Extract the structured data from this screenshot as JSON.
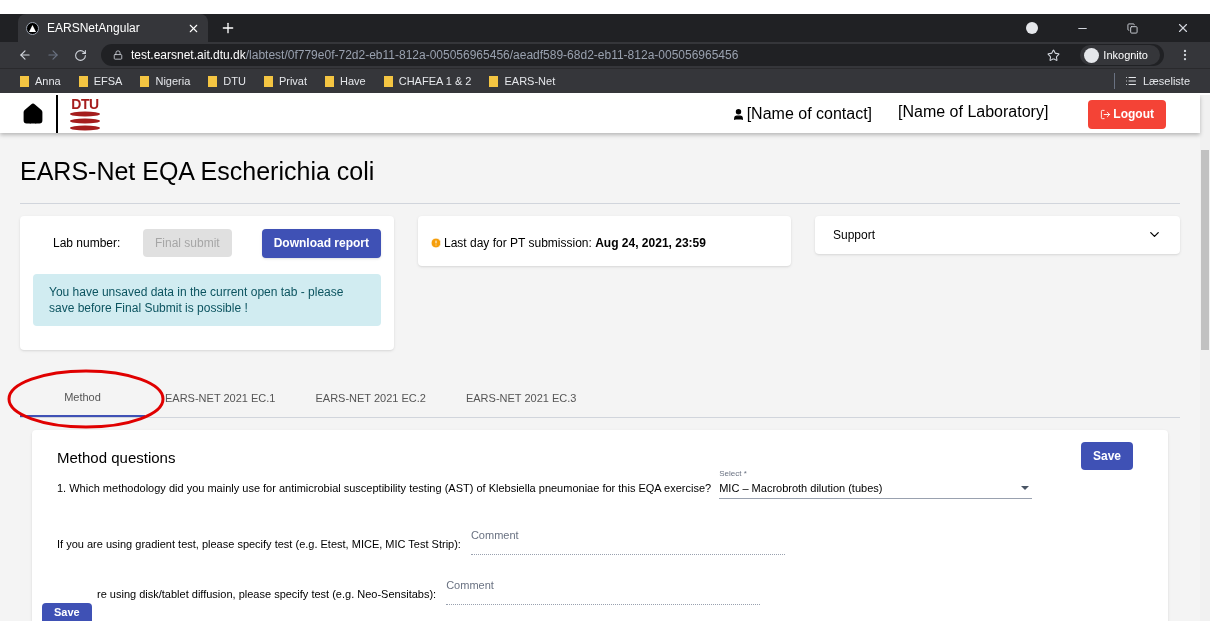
{
  "browser": {
    "tab_title": "EARSNetAngular",
    "url_host": "test.earsnet.ait.dtu.dk",
    "url_path": "/labtest/0f779e0f-72d2-eb11-812a-005056965456/aeadf589-68d2-eb11-812a-005056965456",
    "profile": "Inkognito",
    "bookmarks": [
      "Anna",
      "EFSA",
      "Nigeria",
      "DTU",
      "Privat",
      "Have",
      "CHAFEA 1 & 2",
      "EARS-Net"
    ],
    "reading_list": "Læseliste"
  },
  "header": {
    "logo": "DTU",
    "contact": "[Name of contact]",
    "laboratory": "[Name of Laboratory]",
    "logout": "Logout"
  },
  "page_title": "EARS-Net EQA Escherichia coli",
  "lab_card": {
    "lab_number_label": "Lab number:",
    "final_submit": {
      "label": "Final submit",
      "disabled": true
    },
    "download": "Download report",
    "alert": "You have unsaved data in the current open tab - please save before Final Submit is possible !"
  },
  "deadline": {
    "label": "Last day for PT submission: ",
    "value": "Aug 24, 2021, 23:59"
  },
  "support": {
    "label": "Support",
    "expanded": false
  },
  "tabs": [
    {
      "label": "Method",
      "selected": true
    },
    {
      "label": "EARS-NET 2021 EC.1",
      "selected": false
    },
    {
      "label": "EARS-NET 2021 EC.2",
      "selected": false
    },
    {
      "label": "EARS-NET 2021 EC.3",
      "selected": false
    }
  ],
  "method": {
    "title": "Method questions",
    "save": "Save",
    "questions": [
      {
        "kind": "select",
        "label": "1. Which methodology did you mainly use for antimicrobial susceptibility testing (AST) of Klebsiella pneumoniae for this EQA exercise?",
        "field_label": "Select *",
        "value": "MIC – Macrobroth dilution (tubes)"
      },
      {
        "kind": "comment",
        "label": "If you are using gradient test, please specify test (e.g. Etest, MICE, MIC Test Strip):",
        "placeholder": "Comment"
      },
      {
        "kind": "comment",
        "label": "re using disk/tablet diffusion, please specify test (e.g. Neo-Sensitabs):",
        "placeholder": "Comment"
      }
    ]
  },
  "floating_save": "Save"
}
